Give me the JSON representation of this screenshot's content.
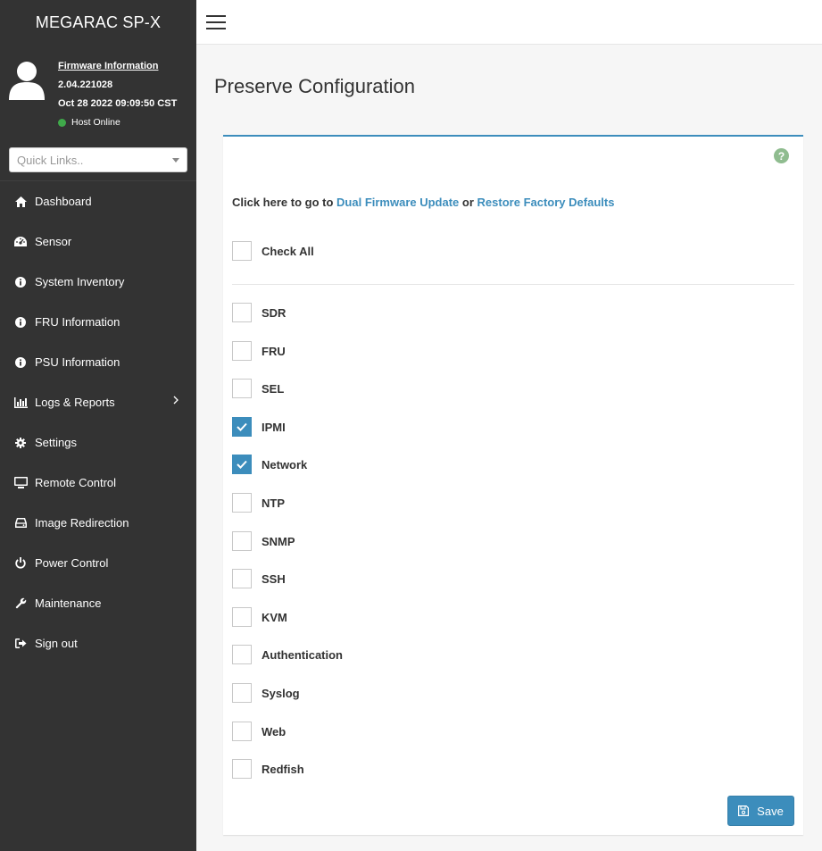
{
  "sidebar": {
    "brand": "MEGARAC SP-X",
    "firmware_link": "Firmware Information",
    "firmware_version": "2.04.221028",
    "firmware_date": "Oct 28 2022 09:09:50 CST",
    "host_status": "Host Online",
    "quick_links_placeholder": "Quick Links..",
    "nav": [
      {
        "label": "Dashboard",
        "icon": "home-icon"
      },
      {
        "label": "Sensor",
        "icon": "gauge-icon"
      },
      {
        "label": "System Inventory",
        "icon": "info-icon"
      },
      {
        "label": "FRU Information",
        "icon": "info-icon"
      },
      {
        "label": "PSU Information",
        "icon": "info-icon"
      },
      {
        "label": "Logs & Reports",
        "icon": "bar-chart-icon"
      },
      {
        "label": "Settings",
        "icon": "gear-icon"
      },
      {
        "label": "Remote Control",
        "icon": "monitor-icon"
      },
      {
        "label": "Image Redirection",
        "icon": "drive-icon"
      },
      {
        "label": "Power Control",
        "icon": "power-icon"
      },
      {
        "label": "Maintenance",
        "icon": "wrench-icon"
      },
      {
        "label": "Sign out",
        "icon": "sign-out-icon"
      }
    ]
  },
  "main": {
    "title": "Preserve Configuration",
    "intro_prefix": "Click here to go to",
    "intro_link1": "Dual Firmware Update",
    "intro_or": "or",
    "intro_link2": "Restore Factory Defaults",
    "check_all_label": "Check All",
    "check_all_checked": false,
    "items": [
      {
        "label": "SDR",
        "checked": false
      },
      {
        "label": "FRU",
        "checked": false
      },
      {
        "label": "SEL",
        "checked": false
      },
      {
        "label": "IPMI",
        "checked": true
      },
      {
        "label": "Network",
        "checked": true
      },
      {
        "label": "NTP",
        "checked": false
      },
      {
        "label": "SNMP",
        "checked": false
      },
      {
        "label": "SSH",
        "checked": false
      },
      {
        "label": "KVM",
        "checked": false
      },
      {
        "label": "Authentication",
        "checked": false
      },
      {
        "label": "Syslog",
        "checked": false
      },
      {
        "label": "Web",
        "checked": false
      },
      {
        "label": "Redfish",
        "checked": false
      }
    ],
    "save_label": "Save",
    "help_glyph": "?"
  },
  "colors": {
    "sidebar_bg": "#333333",
    "accent": "#3c8dbc",
    "status_online": "#3fa94a"
  }
}
